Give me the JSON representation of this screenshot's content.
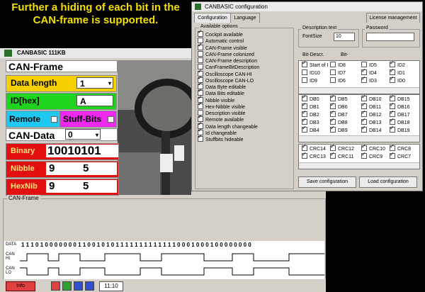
{
  "caption": {
    "line1": "Further a hiding of each bit in the",
    "line2": "CAN-frame is supported."
  },
  "main": {
    "title": "CANBASIC 111KB",
    "can_frame_header": "CAN-Frame",
    "data_length_label": "Data length",
    "data_length_value": "1",
    "id_label": "ID[hex]",
    "id_value": "A",
    "remote_label": "Remote",
    "stuff_bits_label": "Stuff-Bits",
    "can_data_header": "CAN-Data",
    "can_data_value": "0",
    "binary_label": "Binary",
    "binary_value": "10010101",
    "nibble_label": "Nibble",
    "nibble_values": [
      "9",
      "5"
    ],
    "hexnib_label": "HexNib",
    "hexnib_values": [
      "9",
      "5"
    ],
    "frame_group_label": "CAN-Frame",
    "data_label": "DATA",
    "data_bits": "1 1 1 0 1 0 0 0 0 0 0 0 1 1 0 0 1 0 1 0 1 1 1 1 1 1 1 1 1 1 1 1 1 0 0 0 1 0 0 0 1 0 0 0 0 0 0 0 0",
    "can_hi_label": "CAN\nHI",
    "can_lo_label": "CAN\nLO",
    "info_button": "Info",
    "clock": "11:10"
  },
  "config": {
    "title": "CANBASIC configuration",
    "tabs": [
      "Configuration",
      "Language",
      "License management"
    ],
    "available_options_label": "Available options",
    "options": [
      {
        "label": "Cockpit available",
        "checked": true
      },
      {
        "label": "Automatic control",
        "checked": false
      },
      {
        "label": "CAN-Frame visible",
        "checked": true
      },
      {
        "label": "CAN-Frame colonized",
        "checked": false
      },
      {
        "label": "CAN-Frame description",
        "checked": false
      },
      {
        "label": "CanFrameBitDescription",
        "checked": false
      },
      {
        "label": "Oscilloscope CAN-HI",
        "checked": true
      },
      {
        "label": "Oscilloscope CAN-LO",
        "checked": true
      },
      {
        "label": "Data Byte editable",
        "checked": true
      },
      {
        "label": "Data Bits editable",
        "checked": true
      },
      {
        "label": "Nibble visible",
        "checked": true
      },
      {
        "label": "Hex-Nibble visible",
        "checked": true
      },
      {
        "label": "Description visible",
        "checked": false
      },
      {
        "label": "Remote available",
        "checked": true
      },
      {
        "label": "Data length changeable",
        "checked": true
      },
      {
        "label": "Id changeable",
        "checked": true
      },
      {
        "label": "Stuffbits hideable",
        "checked": true
      }
    ],
    "description_text_label": "Description text",
    "fontsize_label": "FontSize",
    "fontsize_value": "10",
    "password_label": "Password",
    "bit_descr_label": "Bit-Descr.",
    "bit_label": "Bit-",
    "id_bits": [
      [
        {
          "label": "Start of I",
          "checked": true
        },
        {
          "label": "ID8",
          "checked": false
        },
        {
          "label": "ID5",
          "checked": false
        },
        {
          "label": "ID2",
          "checked": true
        }
      ],
      [
        {
          "label": "ID10",
          "checked": false
        },
        {
          "label": "ID7",
          "checked": false
        },
        {
          "label": "ID4",
          "checked": true
        },
        {
          "label": "ID1",
          "checked": true
        }
      ],
      [
        {
          "label": "ID9",
          "checked": false
        },
        {
          "label": "ID6",
          "checked": false
        },
        {
          "label": "ID3",
          "checked": true
        },
        {
          "label": "ID0",
          "checked": true
        }
      ]
    ],
    "db_bits": [
      [
        "DB0",
        "DB5",
        "DB10",
        "DB15"
      ],
      [
        "DB1",
        "DB6",
        "DB11",
        "DB16"
      ],
      [
        "DB2",
        "DB7",
        "DB12",
        "DB17"
      ],
      [
        "DB3",
        "DB8",
        "DB13",
        "DB18"
      ],
      [
        "DB4",
        "DB9",
        "DB14",
        "DB19"
      ]
    ],
    "crc_bits": [
      [
        "CRC14",
        "CRC12",
        "CRC10",
        "CRC8"
      ],
      [
        "CRC13",
        "CRC11",
        "CRC9",
        "CRC7"
      ]
    ],
    "save_button": "Save configuration",
    "load_button": "Load configuration"
  }
}
